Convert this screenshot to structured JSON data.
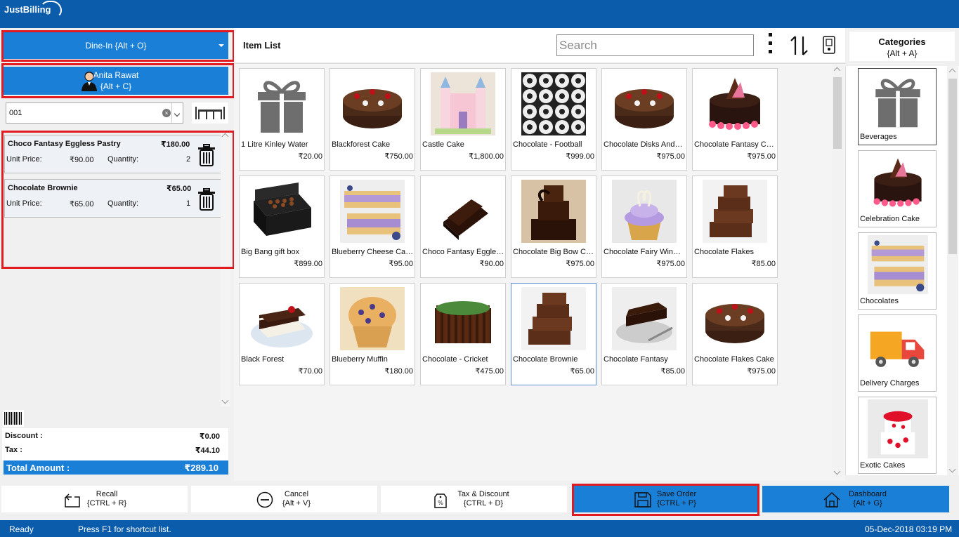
{
  "app": {
    "logo_text": "JustBilling"
  },
  "left": {
    "order_type": "Dine-In {Alt + O}",
    "customer_name": "Anita Rawat",
    "customer_shortcut": "{Alt + C}",
    "table_value": "001",
    "cart": [
      {
        "name": "Choco Fantasy Eggless Pastry",
        "amount": "₹180.00",
        "unit_price_label": "Unit Price:",
        "unit_price": "₹90.00",
        "qty_label": "Quantity:",
        "qty": "2"
      },
      {
        "name": "Chocolate Brownie",
        "amount": "₹65.00",
        "unit_price_label": "Unit Price:",
        "unit_price": "₹65.00",
        "qty_label": "Quantity:",
        "qty": "1"
      }
    ],
    "discount_label": "Discount :",
    "discount_value": "₹0.00",
    "tax_label": "Tax :",
    "tax_value": "₹44.10",
    "total_label": "Total Amount :",
    "total_value": "₹289.10"
  },
  "center": {
    "title": "Item List",
    "search_placeholder": "Search",
    "items": [
      {
        "name": "1 Litre Kinley Water",
        "price": "₹20.00",
        "img": "gift-icon"
      },
      {
        "name": "Blackforest Cake",
        "price": "₹750.00",
        "img": "cake"
      },
      {
        "name": "Castle Cake",
        "price": "₹1,800.00",
        "img": "castle"
      },
      {
        "name": "Chocolate - Football",
        "price": "₹999.00",
        "img": "football"
      },
      {
        "name": "Chocolate Disks And…",
        "price": "₹975.00",
        "img": "cake"
      },
      {
        "name": "Chocolate Fantasy C…",
        "price": "₹975.00",
        "img": "cake-pink"
      },
      {
        "name": "Big Bang gift box",
        "price": "₹899.00",
        "img": "giftbox"
      },
      {
        "name": "Blueberry Cheese Ca…",
        "price": "₹95.00",
        "img": "bars"
      },
      {
        "name": "Choco Fantasy Eggle…",
        "price": "₹90.00",
        "img": "pastry"
      },
      {
        "name": "Chocolate Big Bow C…",
        "price": "₹975.00",
        "img": "tower"
      },
      {
        "name": "Chocolate Fairy Win…",
        "price": "₹975.00",
        "img": "cupcake"
      },
      {
        "name": "Chocolate Flakes",
        "price": "₹85.00",
        "img": "brownies"
      },
      {
        "name": "Black Forest",
        "price": "₹70.00",
        "img": "slice"
      },
      {
        "name": "Blueberry Muffin",
        "price": "₹180.00",
        "img": "muffin"
      },
      {
        "name": "Chocolate - Cricket",
        "price": "₹475.00",
        "img": "cricket"
      },
      {
        "name": "Chocolate Brownie",
        "price": "₹65.00",
        "img": "brownies"
      },
      {
        "name": "Chocolate Fantasy",
        "price": "₹85.00",
        "img": "slice-dark"
      },
      {
        "name": "Chocolate Flakes Cake",
        "price": "₹975.00",
        "img": "cake"
      }
    ]
  },
  "right": {
    "title": "Categories",
    "shortcut": "{Alt + A}",
    "categories": [
      {
        "name": "Beverages",
        "img": "gift-icon"
      },
      {
        "name": "Celebration Cake",
        "img": "cake-pink"
      },
      {
        "name": "Chocolates",
        "img": "bars"
      },
      {
        "name": "Delivery Charges",
        "img": "truck"
      },
      {
        "name": "Exotic Cakes",
        "img": "exotic"
      }
    ]
  },
  "toolbar": {
    "recall": "Recall",
    "recall_sc": "{CTRL + R}",
    "cancel": "Cancel",
    "cancel_sc": "{Alt + V}",
    "taxdisc": "Tax & Discount",
    "taxdisc_sc": "{CTRL + D}",
    "save": "Save Order",
    "save_sc": "{CTRL + P}",
    "dashboard": "Dashboard",
    "dashboard_sc": "{Alt + G}"
  },
  "status": {
    "state": "Ready",
    "hint": "Press F1 for shortcut list.",
    "datetime": "05-Dec-2018 03:19 PM"
  },
  "colors": {
    "primary": "#0b5cab",
    "button_blue": "#1a7fd6",
    "highlight_red": "#e01b22"
  }
}
